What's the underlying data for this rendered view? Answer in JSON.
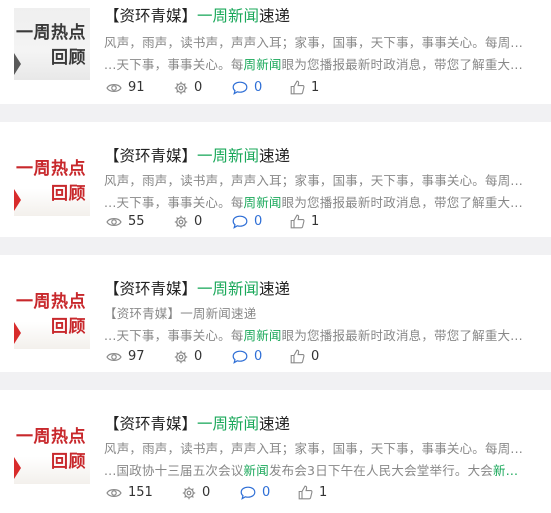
{
  "items": [
    {
      "thumb": {
        "line1": "一周热点",
        "line2": "回顾",
        "style": "gray"
      },
      "title": {
        "prefix": "【资环青媒】",
        "highlight": "一周新闻",
        "suffix": "速递"
      },
      "line1": {
        "a": "风声，雨声，读书声，声声入耳；家事，国事，天下事，事事关心。每周...",
        "hl": "",
        "b": ""
      },
      "line2": {
        "a": "...天下事，事事关心。每",
        "hl": "周新闻",
        "b": "眼为您播报最新时政消息，带您了解重大..."
      },
      "stats": {
        "views": "91",
        "likes_gear": "0",
        "comments": "0",
        "thumbs": "1"
      }
    },
    {
      "thumb": {
        "line1": "一周热点",
        "line2": "回顾",
        "style": "red"
      },
      "title": {
        "prefix": "【资环青媒】",
        "highlight": "一周新闻",
        "suffix": "速递"
      },
      "line1": {
        "a": "风声，雨声，读书声，声声入耳；家事，国事，天下事，事事关心。每周...",
        "hl": "",
        "b": ""
      },
      "line2": {
        "a": "...天下事，事事关心。每",
        "hl": "周新闻",
        "b": "眼为您播报最新时政消息，带您了解重大..."
      },
      "stats": {
        "views": "55",
        "likes_gear": "0",
        "comments": "0",
        "thumbs": "1"
      }
    },
    {
      "thumb": {
        "line1": "一周热点",
        "line2": "回顾",
        "style": "red"
      },
      "title": {
        "prefix": "【资环青媒】",
        "highlight": "一周新闻",
        "suffix": "速递"
      },
      "line1": {
        "a": "【资环青媒】一周新闻速递",
        "hl": "",
        "b": ""
      },
      "line2": {
        "a": "...天下事，事事关心。每",
        "hl": "周新闻",
        "b": "眼为您播报最新时政消息，带您了解重大..."
      },
      "stats": {
        "views": "97",
        "likes_gear": "0",
        "comments": "0",
        "thumbs": "0"
      }
    },
    {
      "thumb": {
        "line1": "一周热点",
        "line2": "回顾",
        "style": "red"
      },
      "title": {
        "prefix": "【资环青媒】",
        "highlight": "一周新闻",
        "suffix": "速递"
      },
      "line1": {
        "a": "风声，雨声，读书声，声声入耳；家事，国事，天下事，事事关心。每周...",
        "hl": "",
        "b": ""
      },
      "line2": {
        "a": "...国政协十三届五次会议",
        "hl": "新闻",
        "b": "发布会3日下午在人民大会堂举行。大会",
        "hl2": "新..."
      },
      "stats": {
        "views": "151",
        "likes_gear": "0",
        "comments": "0",
        "thumbs": "1"
      }
    }
  ]
}
